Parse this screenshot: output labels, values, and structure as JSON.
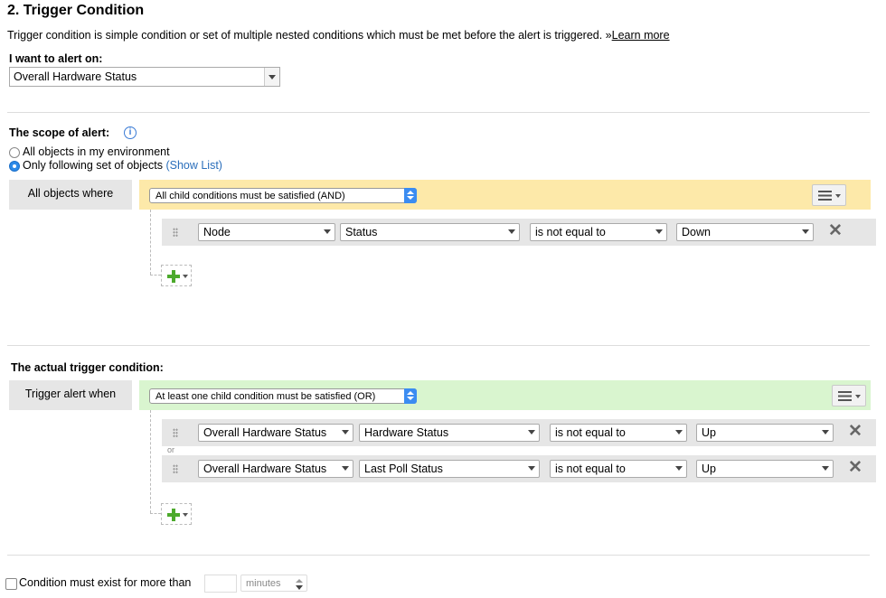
{
  "section_title": "2. Trigger Condition",
  "description": "Trigger condition is simple condition or set of multiple nested conditions which must be met before the alert is triggered. »",
  "learn_more": "Learn more",
  "alert_on": {
    "label": "I want to alert on:",
    "value": "Overall Hardware Status"
  },
  "scope": {
    "label": "The scope of alert:",
    "option_all": "All objects in my environment",
    "option_following": "Only following set of objects",
    "show_list": "(Show List)",
    "selected": "option_following",
    "group_label": "All objects where",
    "group_operator": "All child conditions must be satisfied (AND)",
    "conditions": [
      {
        "field1": "Node",
        "field2": "Status",
        "operator": "is not equal to",
        "value": "Down"
      }
    ]
  },
  "trigger": {
    "label": "The actual trigger condition:",
    "group_label": "Trigger alert when",
    "group_operator": "At least one child condition must be satisfied (OR)",
    "join_word": "or",
    "conditions": [
      {
        "field1": "Overall Hardware Status",
        "field2": "Hardware Status",
        "operator": "is not equal to",
        "value": "Up"
      },
      {
        "field1": "Overall Hardware Status",
        "field2": "Last Poll Status",
        "operator": "is not equal to",
        "value": "Up"
      }
    ]
  },
  "duration": {
    "label": "Condition must exist for more than",
    "value": "",
    "unit": "minutes"
  },
  "colors": {
    "scope_band": "#fde9a9",
    "trigger_band": "#d9f5cf",
    "accent": "#3b8cf1",
    "add_icon": "#4caa2c"
  },
  "icons": [
    "info-icon",
    "grip-icon",
    "remove-x-icon",
    "add-condition-icon",
    "menu-icon"
  ]
}
